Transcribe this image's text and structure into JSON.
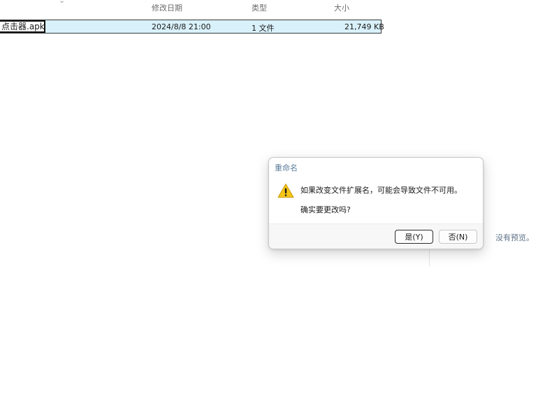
{
  "columns": {
    "modified": "修改日期",
    "type": "类型",
    "size": "大小"
  },
  "file_row": {
    "name_edit_value": "点击器.apk",
    "modified": "2024/8/8 21:00",
    "type": "1 文件",
    "size": "21,749 KB"
  },
  "preview_pane": {
    "message": "没有预览。"
  },
  "dialog": {
    "title": "重命名",
    "icon": "warning-icon",
    "message_line1": "如果改变文件扩展名，可能会导致文件不可用。",
    "message_line2": "确实要更改吗?",
    "yes_label": "是(Y)",
    "no_label": "否(N)"
  },
  "colors": {
    "selection": "#d9f1fb",
    "warning": "#f5c518",
    "title": "#5a7d9a"
  }
}
